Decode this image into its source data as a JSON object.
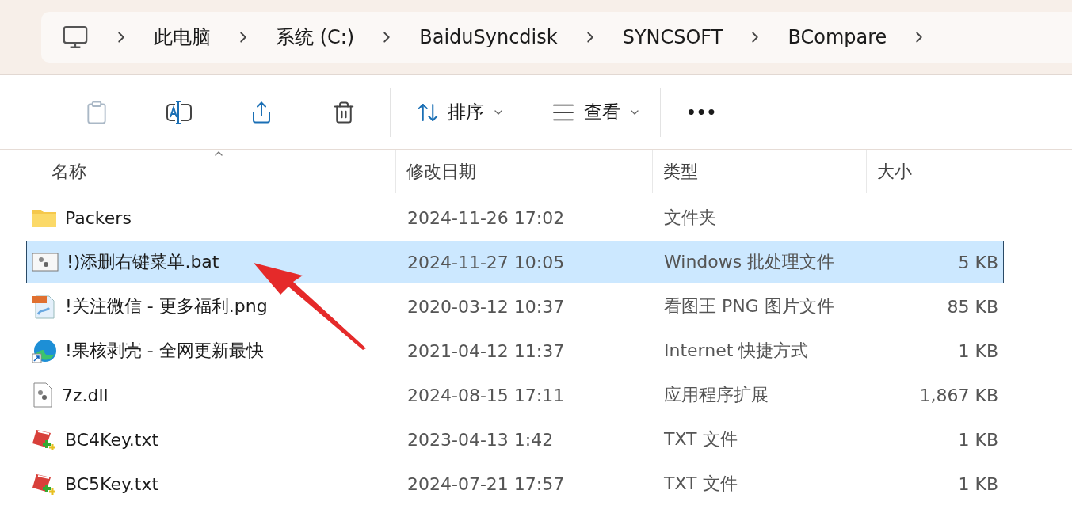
{
  "breadcrumb": [
    "此电脑",
    "系统 (C:)",
    "BaiduSyncdisk",
    "SYNCSOFT",
    "BCompare"
  ],
  "toolbar": {
    "sort": "排序",
    "view": "查看",
    "more": "•••"
  },
  "columns": [
    "名称",
    "修改日期",
    "类型",
    "大小"
  ],
  "rows": [
    {
      "kind": "folder",
      "name": "Packers",
      "date": "2024-11-26 17:02",
      "type": "文件夹",
      "selected": false
    },
    {
      "kind": "bat",
      "name": "!)添删右键菜单.bat",
      "date": "2024-11-27 10:05",
      "type": "Windows 批处理文件",
      "size": "5 KB",
      "selected": true
    },
    {
      "kind": "png",
      "name": "!关注微信 - 更多福利.png",
      "date": "2020-03-12 10:37",
      "type": "看图王 PNG 图片文件",
      "size": "85 KB",
      "selected": false
    },
    {
      "kind": "shortcut",
      "name": "!果核剥壳 - 全网更新最快",
      "date": "2021-04-12 11:37",
      "type": "Internet 快捷方式",
      "size": "1 KB",
      "selected": false
    },
    {
      "kind": "dll",
      "name": "7z.dll",
      "date": "2024-08-15 17:11",
      "type": "应用程序扩展",
      "size": "1,867 KB",
      "selected": false
    },
    {
      "kind": "txt",
      "name": "BC4Key.txt",
      "date": "2023-04-13 1:42",
      "type": "TXT 文件",
      "size": "1 KB",
      "selected": false
    },
    {
      "kind": "txt",
      "name": "BC5Key.txt",
      "date": "2024-07-21 17:57",
      "type": "TXT 文件",
      "size": "1 KB",
      "selected": false
    }
  ]
}
